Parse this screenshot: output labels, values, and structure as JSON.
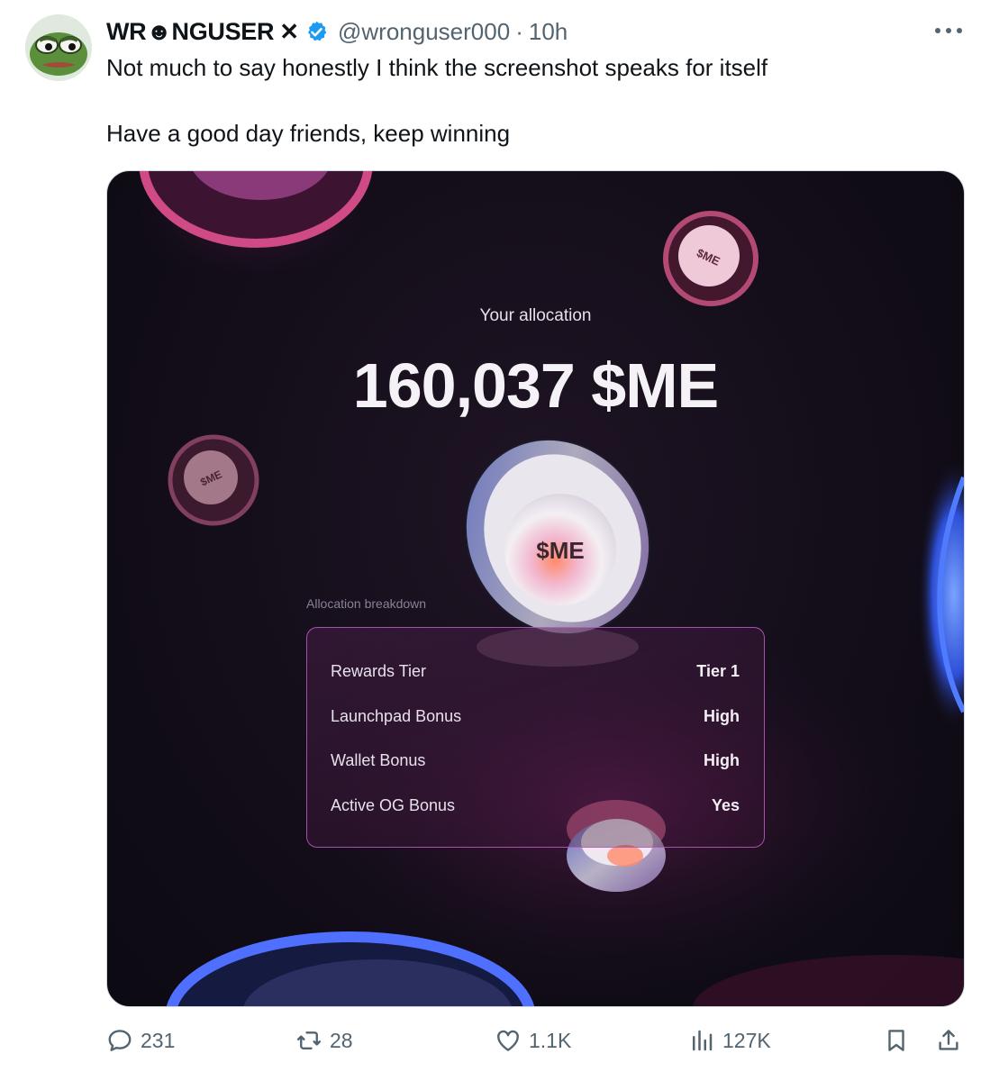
{
  "tweet": {
    "author_name": "WR☻NGUSER",
    "x_mark": "✕",
    "handle": "@wronguser000",
    "separator": "·",
    "time": "10h",
    "text_line_1": "Not much to say honestly I think the screenshot speaks for itself",
    "text_line_2": "Have a good day friends, keep winning"
  },
  "media": {
    "allocation_label": "Your allocation",
    "allocation_value": "160,037 $ME",
    "coin_logo": "$ME",
    "breakdown_title": "Allocation breakdown",
    "rows": [
      {
        "label": "Rewards Tier",
        "value": "Tier 1"
      },
      {
        "label": "Launchpad Bonus",
        "value": "High"
      },
      {
        "label": "Wallet Bonus",
        "value": "High"
      },
      {
        "label": "Active OG Bonus",
        "value": "Yes"
      }
    ]
  },
  "actions": {
    "replies": "231",
    "reposts": "28",
    "likes": "1.1K",
    "views": "127K"
  },
  "colors": {
    "verified": "#1d9bf0",
    "muted_text": "#536471",
    "accent_border": "#be5ac8"
  },
  "icons": [
    "more-icon",
    "verified-badge-icon",
    "reply-icon",
    "repost-icon",
    "like-icon",
    "views-icon",
    "bookmark-icon",
    "share-icon"
  ]
}
